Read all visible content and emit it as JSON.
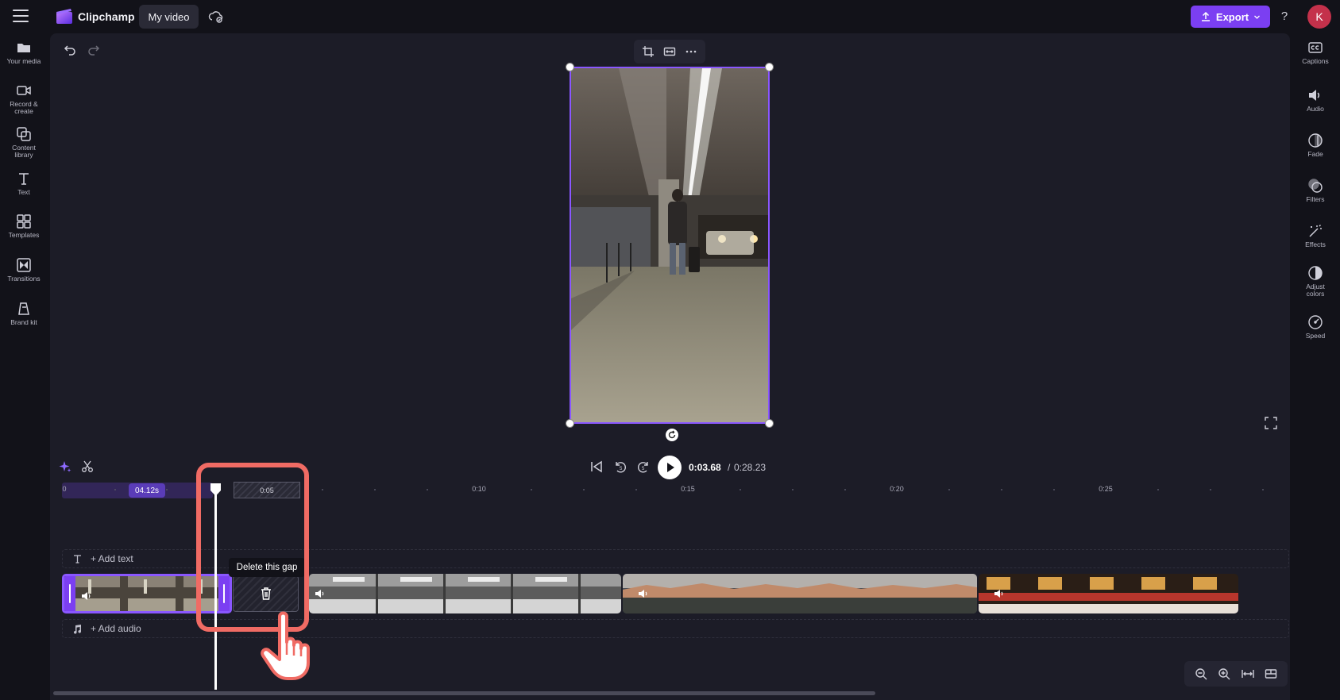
{
  "topbar": {
    "app_name": "Clipchamp",
    "project_name": "My video",
    "export_label": "Export",
    "help_label": "?",
    "avatar_initial": "K"
  },
  "left_sidebar": [
    {
      "label_1": "Your media",
      "label_2": "",
      "icon": "folder-icon"
    },
    {
      "label_1": "Record &",
      "label_2": "create",
      "icon": "camera-icon"
    },
    {
      "label_1": "Content",
      "label_2": "library",
      "icon": "content-library-icon"
    },
    {
      "label_1": "Text",
      "label_2": "",
      "icon": "text-icon"
    },
    {
      "label_1": "Templates",
      "label_2": "",
      "icon": "templates-icon"
    },
    {
      "label_1": "Transitions",
      "label_2": "",
      "icon": "transitions-icon"
    },
    {
      "label_1": "Brand kit",
      "label_2": "",
      "icon": "brand-kit-icon"
    }
  ],
  "right_sidebar": [
    {
      "label_1": "Captions",
      "label_2": "",
      "icon": "captions-icon"
    },
    {
      "label_1": "Audio",
      "label_2": "",
      "icon": "speaker-icon"
    },
    {
      "label_1": "Fade",
      "label_2": "",
      "icon": "fade-icon"
    },
    {
      "label_1": "Filters",
      "label_2": "",
      "icon": "filters-icon"
    },
    {
      "label_1": "Effects",
      "label_2": "",
      "icon": "magic-wand-icon"
    },
    {
      "label_1": "Adjust",
      "label_2": "colors",
      "icon": "adjust-colors-icon"
    },
    {
      "label_1": "Speed",
      "label_2": "",
      "icon": "speedometer-icon"
    }
  ],
  "playback": {
    "current_time": "0:03.68",
    "separator": "/",
    "total_time": "0:28.23"
  },
  "ruler": {
    "start": "0",
    "selection_duration": "04.12s",
    "gap_label": "0:05",
    "marks": [
      "0:10",
      "0:15",
      "0:20",
      "0:25"
    ]
  },
  "tracks": {
    "add_text_label": "+ Add text",
    "add_audio_label": "+ Add audio"
  },
  "tooltip": {
    "text": "Delete this gap"
  },
  "colors": {
    "accent": "#7b3ff2",
    "selection_border": "#8a57ff",
    "highlight_box": "#f06b64",
    "avatar": "#c4314b"
  }
}
